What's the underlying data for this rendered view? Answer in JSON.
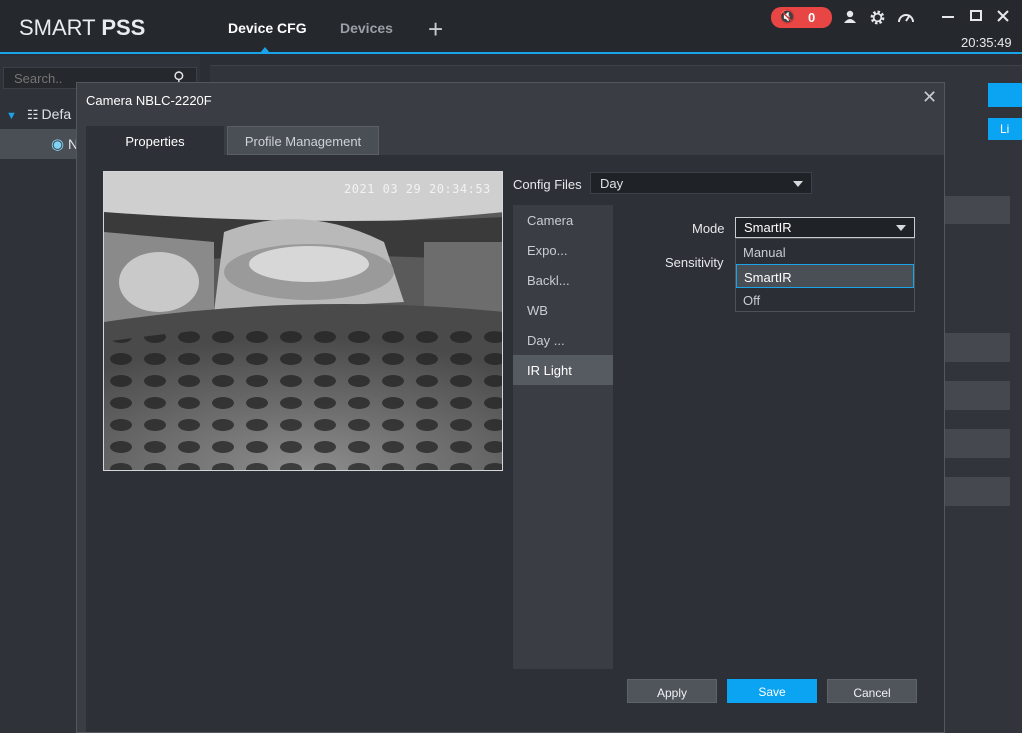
{
  "app": {
    "logo_regular": "SMART ",
    "logo_bold": "PSS",
    "tabs": [
      {
        "label": "Device CFG",
        "active": true
      },
      {
        "label": "Devices",
        "active": false
      }
    ],
    "add_tab_icon": "plus-icon",
    "alarm_count": "0",
    "clock": "20:35:49",
    "accent_color": "#1aa3e8",
    "alarm_color": "#e84545"
  },
  "sidebar": {
    "search_placeholder": "Search..",
    "tree_root_label": "Defa",
    "tree_child_label": "N"
  },
  "background": {
    "button_label": "Li"
  },
  "dialog": {
    "title": "Camera NBLC-2220F",
    "tabs": [
      {
        "label": "Properties",
        "active": true
      },
      {
        "label": "Profile Management",
        "active": false
      }
    ],
    "video_timestamp": "2021 03 29 20:34:53",
    "config_files_label": "Config Files",
    "config_files_value": "Day",
    "menu": [
      {
        "label": "Camera",
        "selected": false
      },
      {
        "label": "Expo...",
        "selected": false
      },
      {
        "label": "Backl...",
        "selected": false
      },
      {
        "label": "WB",
        "selected": false
      },
      {
        "label": "Day ...",
        "selected": false
      },
      {
        "label": "IR Light",
        "selected": true
      }
    ],
    "mode_label": "Mode",
    "mode_value": "SmartIR",
    "sensitivity_label": "Sensitivity",
    "mode_options": [
      {
        "label": "Manual",
        "selected": false
      },
      {
        "label": "SmartIR",
        "selected": true
      },
      {
        "label": "Off",
        "selected": false
      }
    ],
    "buttons": {
      "apply": "Apply",
      "save": "Save",
      "cancel": "Cancel"
    }
  }
}
